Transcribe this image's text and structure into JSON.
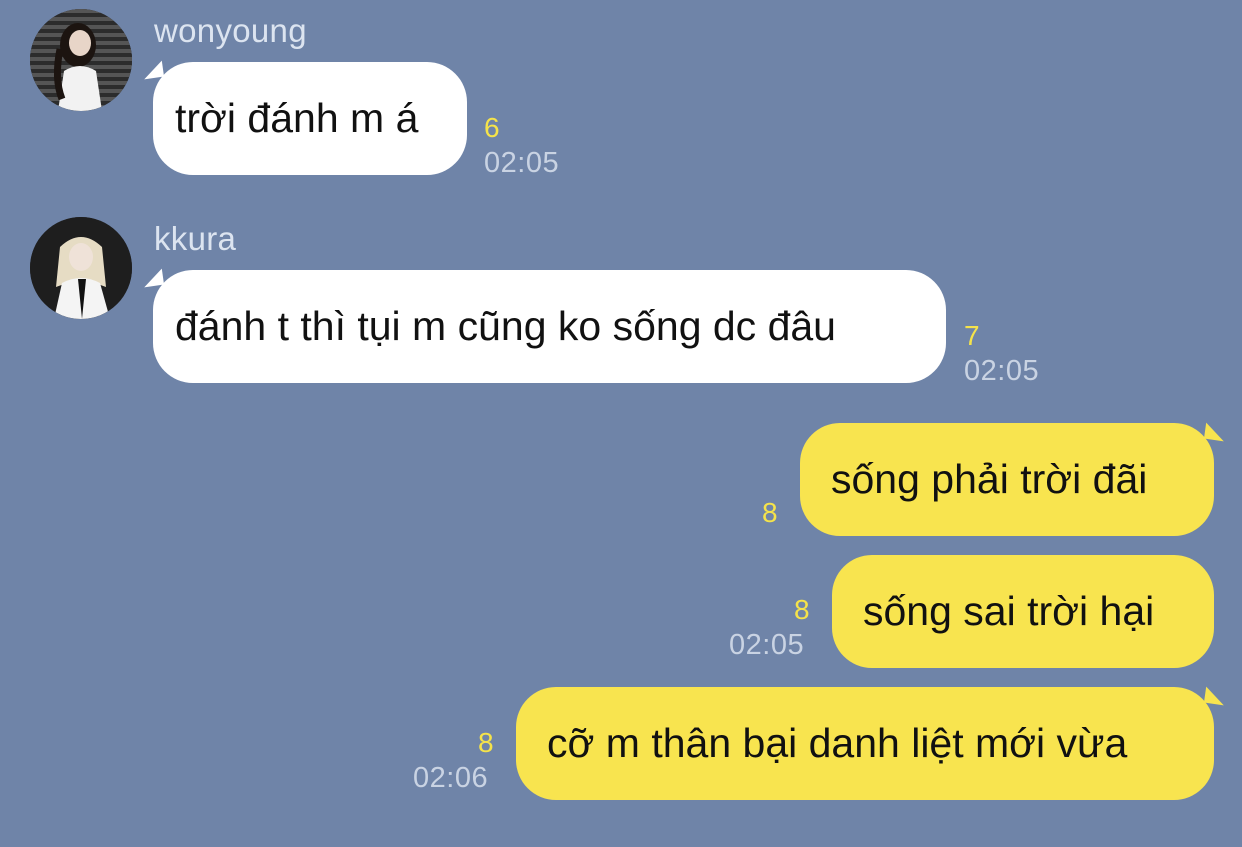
{
  "messages": [
    {
      "sender": "wonyoung",
      "avatar_icon": "avatar-wonyoung-icon",
      "text": "trời đánh m á",
      "read_count": "6",
      "time": "02:05"
    },
    {
      "sender": "kkura",
      "avatar_icon": "avatar-kkura-icon",
      "text": "đánh t thì tụi m cũng ko sống dc đâu",
      "read_count": "7",
      "time": "02:05"
    },
    {
      "sender": "me",
      "text": "sống phải trời đãi",
      "read_count": "8",
      "time": ""
    },
    {
      "sender": "me",
      "text": "sống sai trời hại",
      "read_count": "8",
      "time": "02:05"
    },
    {
      "sender": "me",
      "text": "cỡ m thân bại danh liệt mới vừa",
      "read_count": "8",
      "time": "02:06"
    }
  ],
  "colors": {
    "background": "#6f84a8",
    "incoming_bubble": "#ffffff",
    "outgoing_bubble": "#f8e44f",
    "read_count": "#f5e34a",
    "timestamp": "#c9d3e3"
  }
}
